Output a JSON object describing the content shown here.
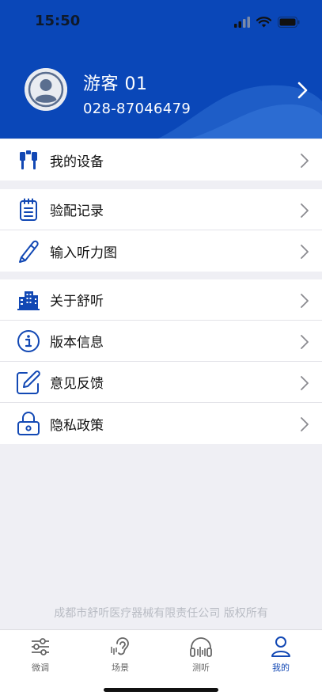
{
  "status_bar": {
    "time": "15:50"
  },
  "profile": {
    "name": "游客 01",
    "phone": "028-87046479"
  },
  "menu": {
    "group1": [
      {
        "label": "我的设备",
        "icon": "headphones-device-icon"
      }
    ],
    "group2": [
      {
        "label": "验配记录",
        "icon": "notepad-icon"
      },
      {
        "label": "输入听力图",
        "icon": "pencil-icon"
      }
    ],
    "group3": [
      {
        "label": "关于舒听",
        "icon": "building-icon"
      },
      {
        "label": "版本信息",
        "icon": "info-icon"
      },
      {
        "label": "意见反馈",
        "icon": "edit-icon"
      },
      {
        "label": "隐私政策",
        "icon": "lock-icon"
      }
    ]
  },
  "footer": {
    "copyright": "成都市舒听医疗器械有限责任公司 版权所有"
  },
  "tabbar": {
    "tabs": [
      {
        "label": "微调",
        "icon": "sliders-icon",
        "active": false
      },
      {
        "label": "场景",
        "icon": "ear-icon",
        "active": false
      },
      {
        "label": "测听",
        "icon": "headset-icon",
        "active": false
      },
      {
        "label": "我的",
        "icon": "person-icon",
        "active": true
      }
    ]
  },
  "colors": {
    "brand": "#0a47b8",
    "active_tab": "#1248b4",
    "background": "#efeff4"
  }
}
